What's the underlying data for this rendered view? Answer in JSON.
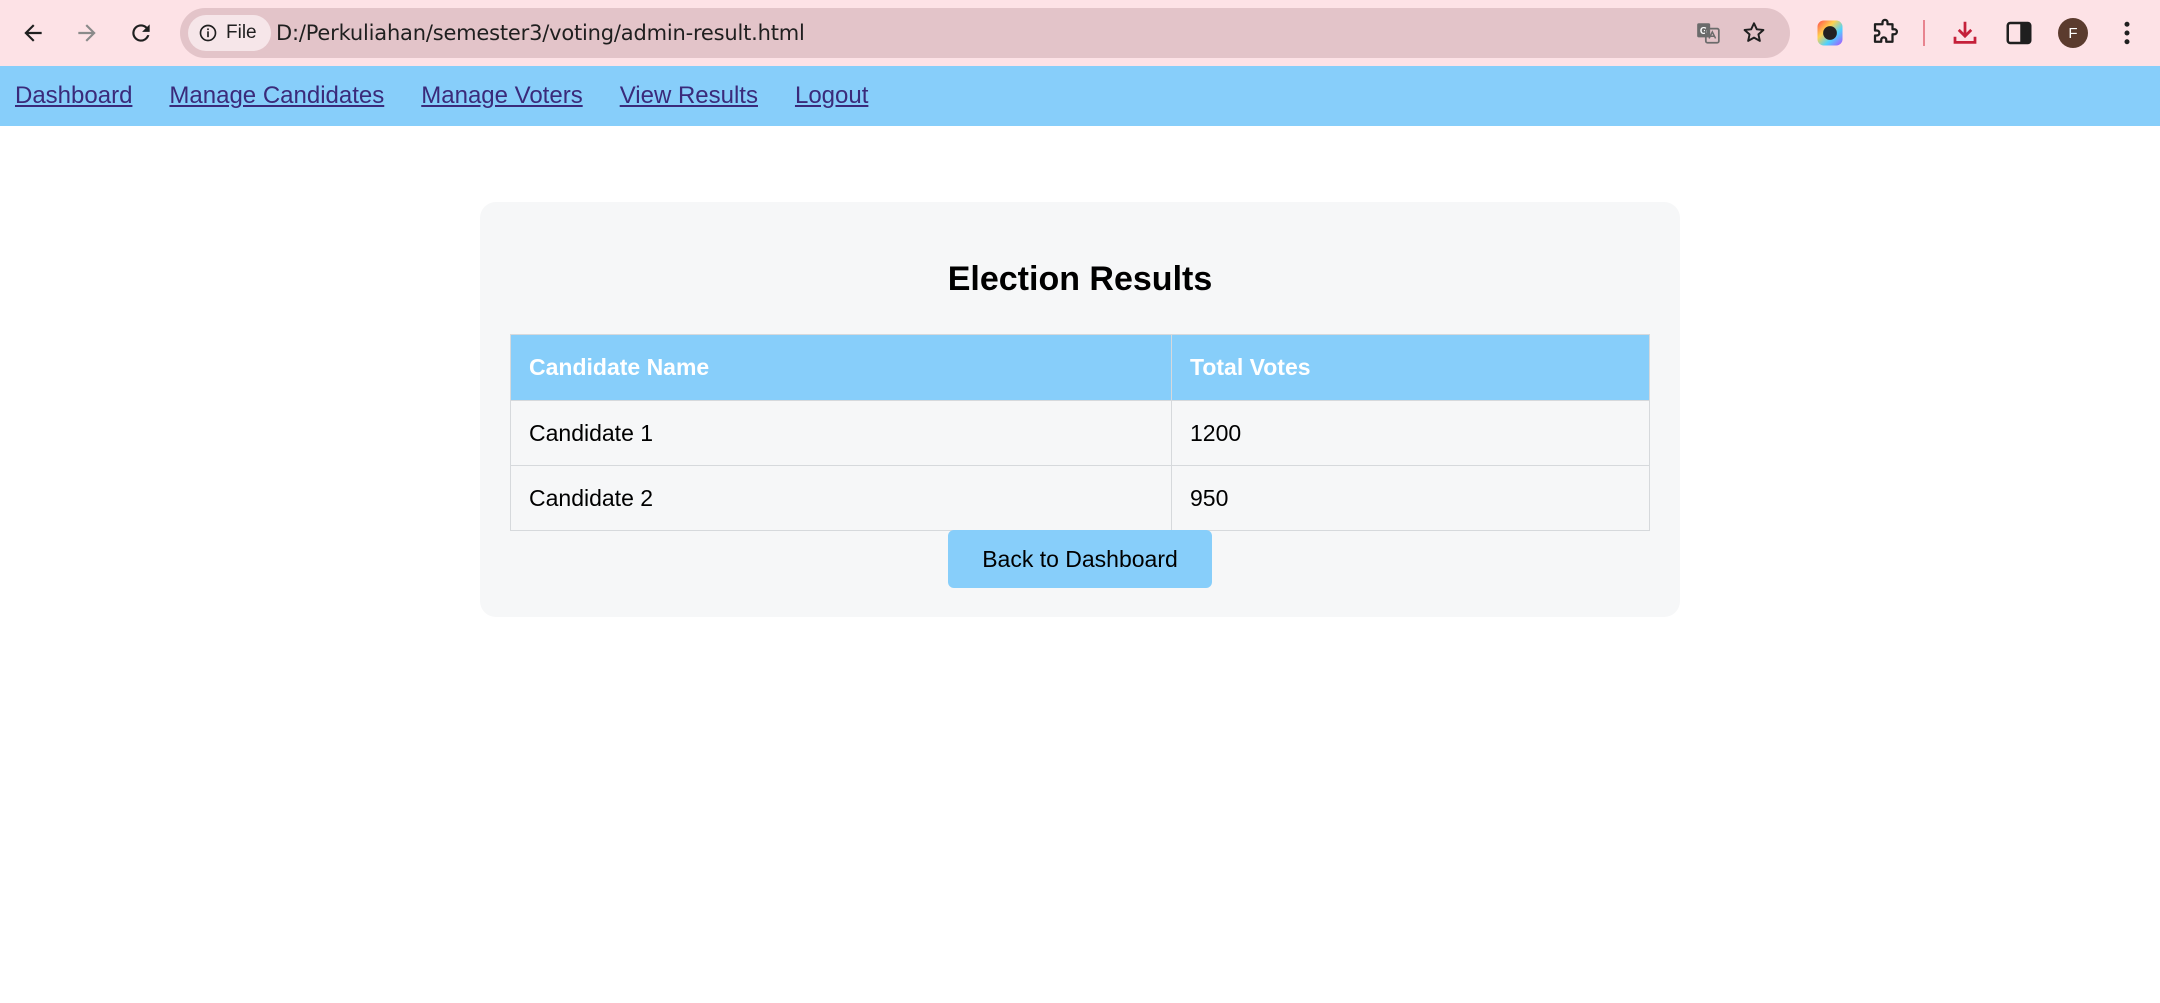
{
  "browser": {
    "file_chip_label": "File",
    "url": "D:/Perkuliahan/semester3/voting/admin-result.html",
    "profile_initial": "F"
  },
  "nav": {
    "links": [
      "Dashboard",
      "Manage Candidates",
      "Manage Voters",
      "View Results",
      "Logout"
    ]
  },
  "card": {
    "title": "Election Results",
    "table": {
      "headers": [
        "Candidate Name",
        "Total Votes"
      ],
      "rows": [
        [
          "Candidate 1",
          "1200"
        ],
        [
          "Candidate 2",
          "950"
        ]
      ]
    },
    "back_button_label": "Back to Dashboard"
  },
  "colors": {
    "accent": "#87cefa",
    "toolbar": "#fde2e6",
    "card_bg": "#f6f7f8"
  }
}
